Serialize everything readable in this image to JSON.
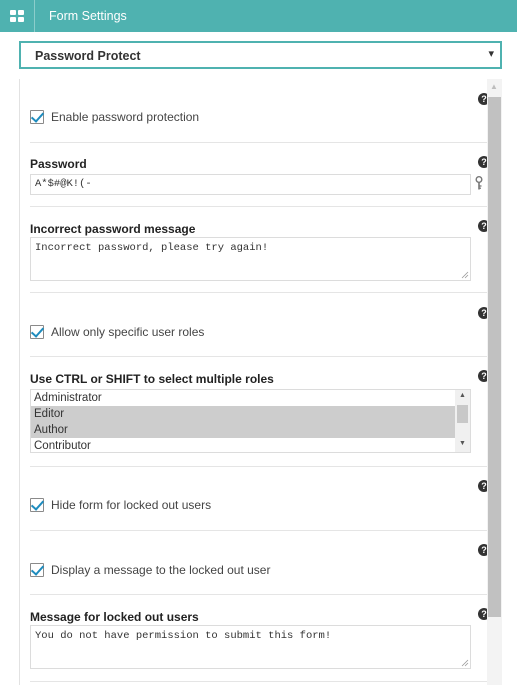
{
  "header": {
    "title": "Form Settings"
  },
  "select": {
    "value": "Password Protect",
    "arrow": "▾"
  },
  "sections": {
    "enable": {
      "label": "Enable password protection",
      "checked": true
    },
    "password": {
      "label": "Password",
      "value": "A*$#@K!(-"
    },
    "incorrect": {
      "label": "Incorrect password message",
      "value": "Incorrect password, please try again!"
    },
    "roles_toggle": {
      "label": "Allow only specific user roles",
      "checked": true
    },
    "roles": {
      "label": "Use CTRL or SHIFT to select multiple roles",
      "options": [
        {
          "label": "Administrator",
          "selected": false
        },
        {
          "label": "Editor",
          "selected": true
        },
        {
          "label": "Author",
          "selected": true
        },
        {
          "label": "Contributor",
          "selected": false
        }
      ]
    },
    "hide_locked": {
      "label": "Hide form for locked out users",
      "checked": true
    },
    "display_msg": {
      "label": "Display a message to the locked out user",
      "checked": true
    },
    "locked_msg": {
      "label": "Message for locked out users",
      "value": "You do not have permission to submit this form!"
    }
  },
  "help": {
    "glyph": "?"
  },
  "colors": {
    "accent": "#4fb2b0",
    "checkmark": "#1e8cbe"
  },
  "icons": {
    "apps": "grid-icon",
    "help": "help-icon",
    "key": "key-icon"
  }
}
